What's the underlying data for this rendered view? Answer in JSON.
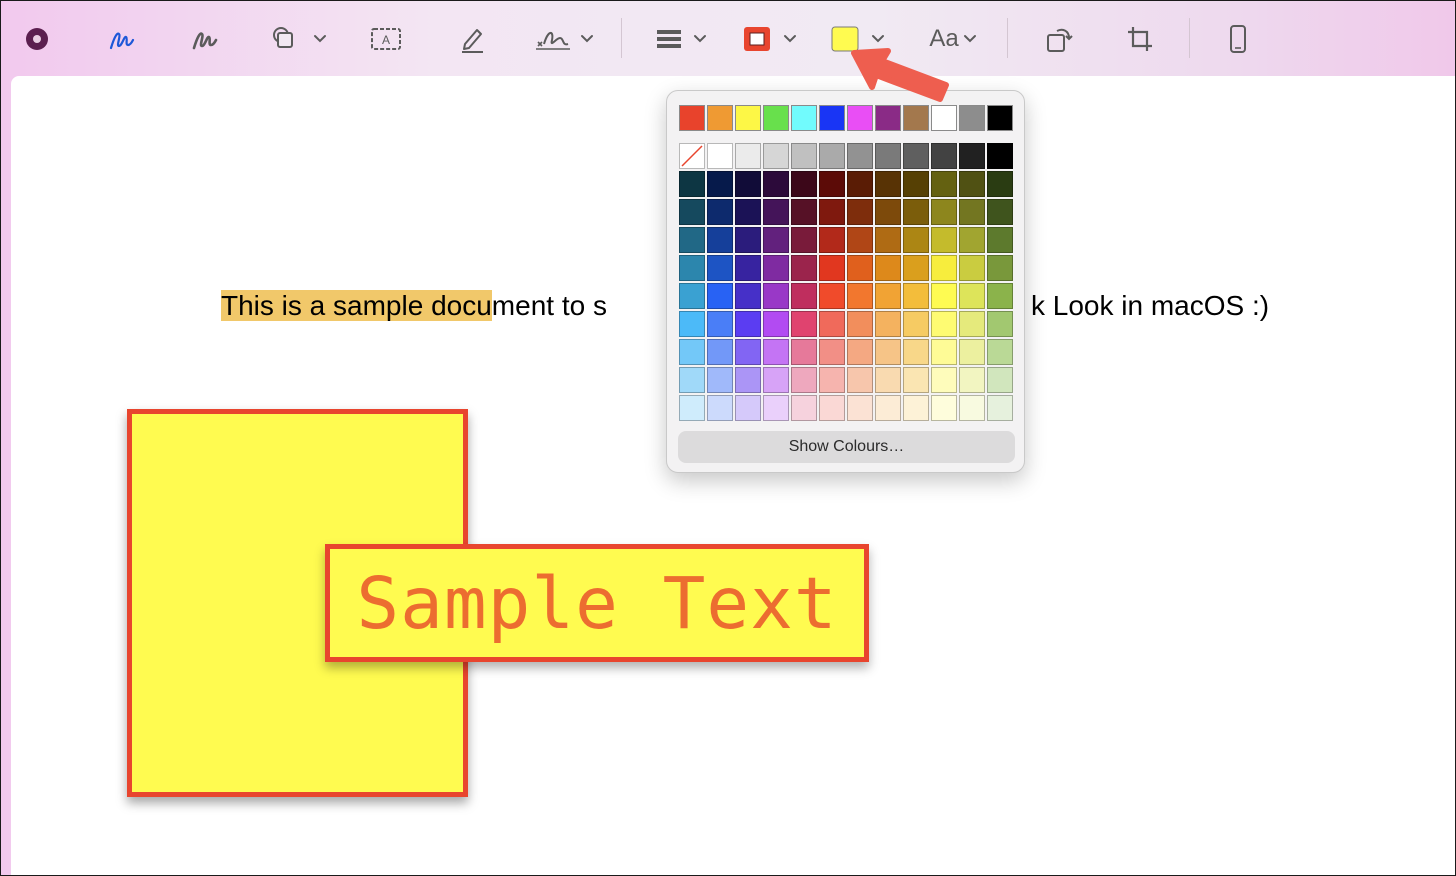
{
  "toolbar": {
    "tools": [
      {
        "name": "markup-icon"
      },
      {
        "name": "sketch-icon"
      },
      {
        "name": "draw-icon"
      },
      {
        "name": "shapes-icon"
      },
      {
        "name": "text-box-icon"
      },
      {
        "name": "highlight-icon"
      },
      {
        "name": "sign-icon"
      },
      {
        "name": "shape-style-icon"
      },
      {
        "name": "border-colour-icon"
      },
      {
        "name": "fill-colour-icon"
      },
      {
        "name": "text-style-icon"
      },
      {
        "name": "rotate-icon"
      },
      {
        "name": "crop-icon"
      },
      {
        "name": "device-icon"
      }
    ],
    "text_style_label": "Aa",
    "border_colour": "#e8452e",
    "fill_colour": "#fffb50"
  },
  "document": {
    "line_highlighted": "This is a sample docu",
    "line_rest_left": "ment to s",
    "line_rest_right": "k Look in macOS :)"
  },
  "annotation": {
    "text": "Sample Text",
    "fill": "#fffb50",
    "border": "#e8452e",
    "text_colour": "#ec6d30"
  },
  "colour_popover": {
    "recent_colours": [
      "#e8432c",
      "#ef9a33",
      "#fdf746",
      "#68e04c",
      "#71fbfd",
      "#1935f5",
      "#e94ef5",
      "#8a2b86",
      "#a3784d",
      "#ffffff",
      "#8d8d8d",
      "#000000"
    ],
    "grid": [
      [
        "none",
        "#ffffff",
        "#ebebeb",
        "#d6d6d6",
        "#c0c0c0",
        "#aaaaaa",
        "#929292",
        "#7a7a7a",
        "#5f5f5f",
        "#424242",
        "#212121",
        "#000000"
      ],
      [
        "#0d3643",
        "#061a4b",
        "#110c38",
        "#2c0a3a",
        "#3c0719",
        "#5c0b07",
        "#5a1c05",
        "#583305",
        "#564004",
        "#646111",
        "#505113",
        "#2a3c12"
      ],
      [
        "#15495e",
        "#0d2a6d",
        "#1b1256",
        "#441459",
        "#561126",
        "#7f190e",
        "#7e2d0c",
        "#7d4a0b",
        "#7b5d0b",
        "#8d861d",
        "#737621",
        "#3f541d"
      ],
      [
        "#216886",
        "#153f9a",
        "#2b1c7c",
        "#62217d",
        "#791b3a",
        "#b2291a",
        "#b04616",
        "#af6b14",
        "#ac8614",
        "#c4bb2c",
        "#a1a530",
        "#5d7a2d"
      ],
      [
        "#2c86ad",
        "#1d54c4",
        "#3723a0",
        "#7f2ba1",
        "#9b244c",
        "#e1371f",
        "#e0601d",
        "#dd891b",
        "#da9f1d",
        "#f7ed3d",
        "#cacc40",
        "#79983b"
      ],
      [
        "#3aa1d2",
        "#2862f4",
        "#4630c8",
        "#9938c7",
        "#bf2e5e",
        "#f04b2b",
        "#f2772e",
        "#f1a334",
        "#f3bd3b",
        "#fefb52",
        "#dde45a",
        "#8bb34b"
      ],
      [
        "#4cbaf8",
        "#4a7ef7",
        "#5b3df2",
        "#b24bf2",
        "#e0436f",
        "#f06a5b",
        "#f28e5c",
        "#f4b25f",
        "#f6cb63",
        "#fefb72",
        "#e5ea7c",
        "#a2c870"
      ],
      [
        "#73c8f8",
        "#7298f8",
        "#8265f3",
        "#c474f4",
        "#e6799a",
        "#f28f86",
        "#f4a882",
        "#f6c487",
        "#f8d789",
        "#fefb96",
        "#ecf09f",
        "#bad996"
      ],
      [
        "#a0d9f9",
        "#a0b9fa",
        "#ab95f6",
        "#d7a3f7",
        "#eea8be",
        "#f6b4ae",
        "#f7c6ac",
        "#f9dab0",
        "#fae5b2",
        "#fefcbb",
        "#f2f5c1",
        "#d1e6bd"
      ],
      [
        "#cfecfc",
        "#ccdafc",
        "#d5c9fa",
        "#ead0fb",
        "#f6d2dd",
        "#fad8d5",
        "#fbe2d4",
        "#fcecd6",
        "#fdf2d7",
        "#fefddc",
        "#f8fae0",
        "#e6f1dd"
      ]
    ],
    "show_colours_label": "Show Colours…"
  }
}
